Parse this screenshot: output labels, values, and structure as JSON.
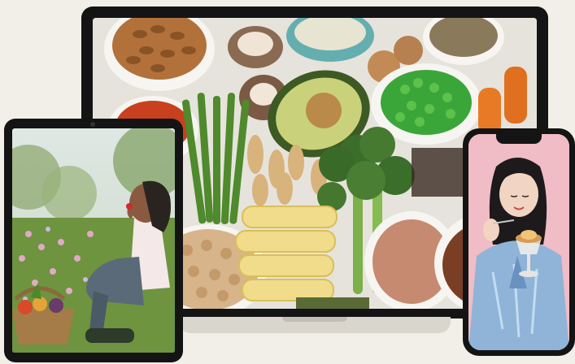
{
  "scene": {
    "laptop_image": "flat-lay-vegetarian-food",
    "tablet_image": "woman-eating-strawberry-in-garden",
    "phone_image": "woman-eating-dessert"
  },
  "colors": {
    "background": "#f1efe8",
    "device_frame": "#141414",
    "laptop_base": "#d9d6ce",
    "phone_screen_bg": "#f0bcc6"
  }
}
